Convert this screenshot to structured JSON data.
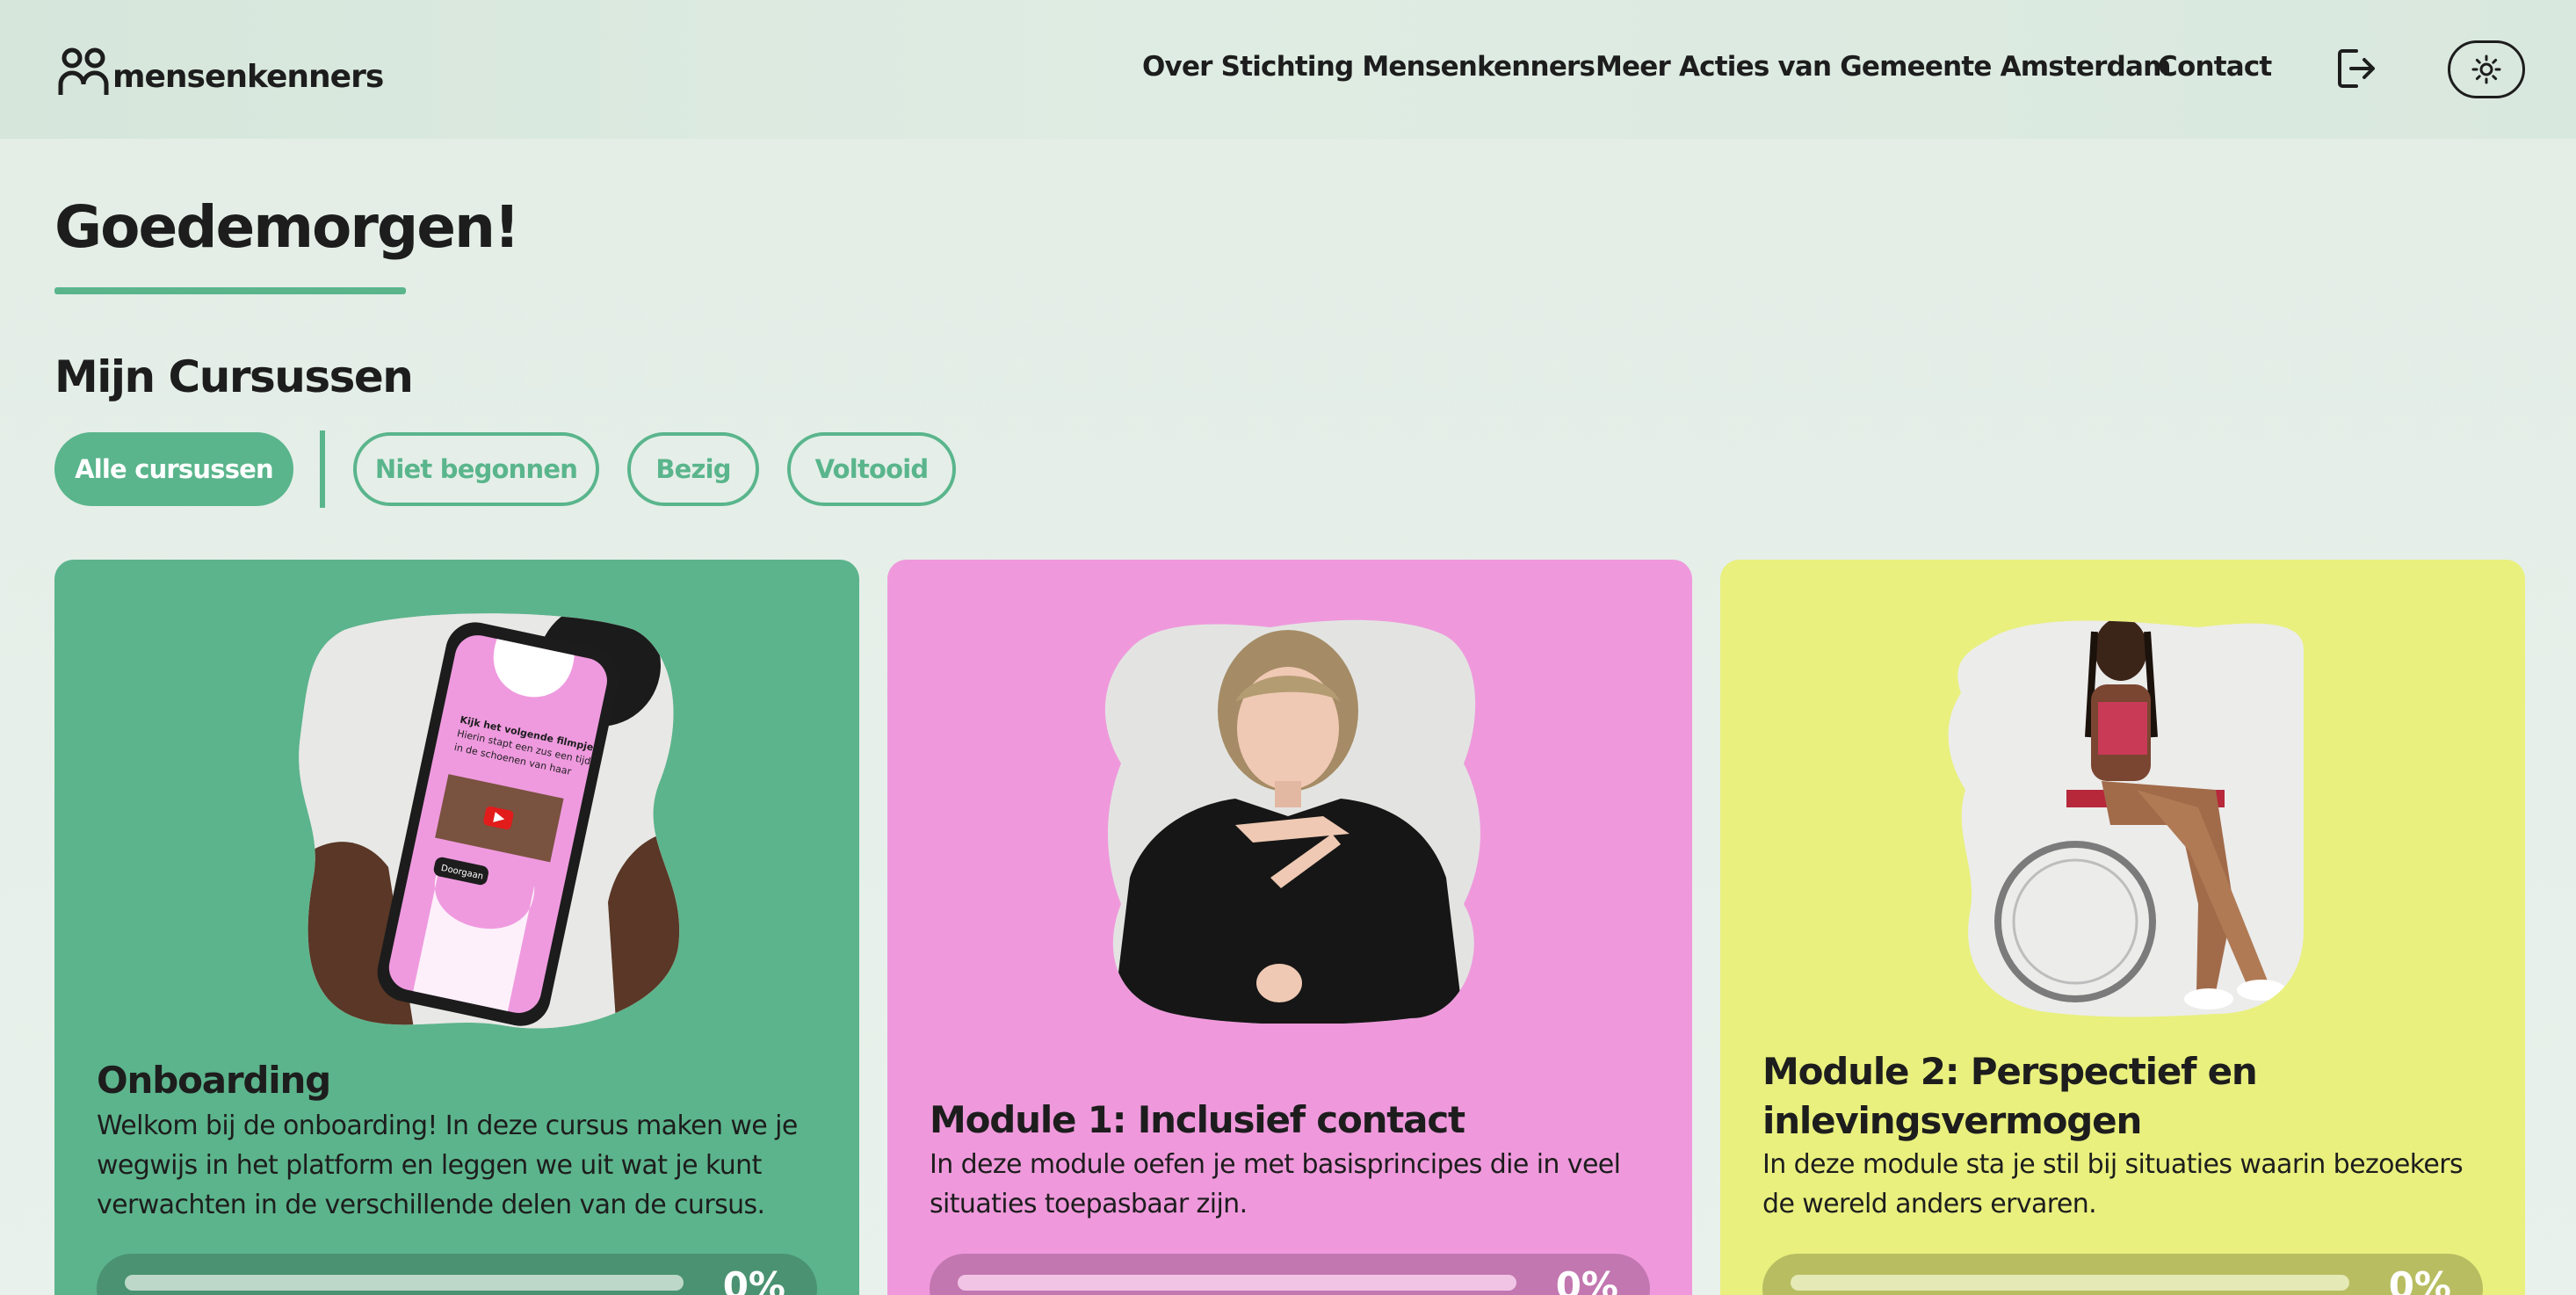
{
  "brand": {
    "name": "mensenkenners"
  },
  "nav": {
    "links": [
      "Over Stichting Mensenkenners",
      "Meer Acties van Gemeente Amsterdam",
      "Contact"
    ],
    "logout_icon": "logout-icon",
    "theme_icon": "sun-icon"
  },
  "greeting": "Goedemorgen!",
  "section_title": "Mijn Cursussen",
  "filters": [
    {
      "label": "Alle cursussen",
      "active": true
    },
    {
      "label": "Niet begonnen",
      "active": false
    },
    {
      "label": "Bezig",
      "active": false
    },
    {
      "label": "Voltooid",
      "active": false
    }
  ],
  "colors": {
    "accent": "#5ab58c",
    "card_green": "#5cb48c",
    "card_pink": "#ef99dc",
    "card_yellow": "#e9f07e"
  },
  "courses": [
    {
      "title": "Onboarding",
      "description": "Welkom bij de onboarding! In deze cursus maken we je wegwijs in het platform en leggen we uit wat je kunt verwachten in de verschillende delen van de cursus.",
      "progress": "0%",
      "image": "phone-in-hand-illustration",
      "phone_text": "Kijk het volgende filmpje. Hierin stapt een zus een tijdje in de schoenen van haar visueel beperkte broer.",
      "phone_button": "Doorgaan"
    },
    {
      "title": "Module 1: Inclusief contact",
      "description": "In deze module oefen je met basisprincipes die in veel situaties toepasbaar zijn.",
      "progress": "0%",
      "image": "sign-language-person-photo"
    },
    {
      "title": "Module 2: Perspectief en inlevingsvermogen",
      "description": "In deze module sta je stil bij situaties waarin bezoekers de wereld anders ervaren.",
      "progress": "0%",
      "image": "wheelchair-person-photo"
    }
  ]
}
